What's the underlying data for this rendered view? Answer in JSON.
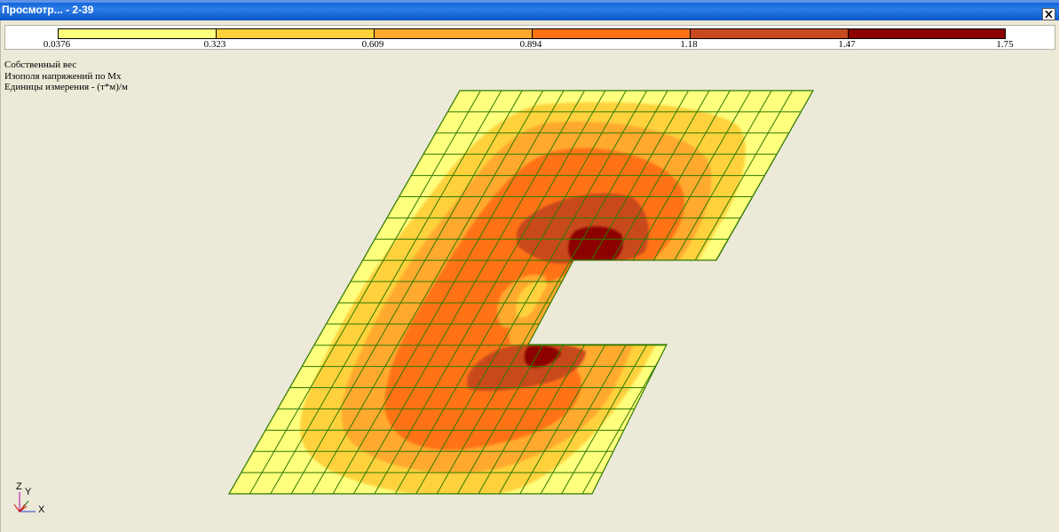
{
  "window": {
    "title": "Просмотр... - 2-39"
  },
  "legend": {
    "ticks": [
      "0.0376",
      "0.323",
      "0.609",
      "0.894",
      "1.18",
      "1.47",
      "1.75"
    ],
    "colors": [
      "#FFFF7E",
      "#FFD23C",
      "#FFAA2E",
      "#FF7314",
      "#C84A1E",
      "#8C0000"
    ]
  },
  "info": {
    "line1": "Собственный вес",
    "line2": "Изополя напряжений по Mx",
    "line3": "Единицы измерения - (т*м)/м"
  },
  "axes": {
    "z": "Z",
    "y": "Y",
    "x": "X"
  },
  "plot": {
    "mesh_color": "#2E7A00",
    "background": "#ECE9D8"
  }
}
